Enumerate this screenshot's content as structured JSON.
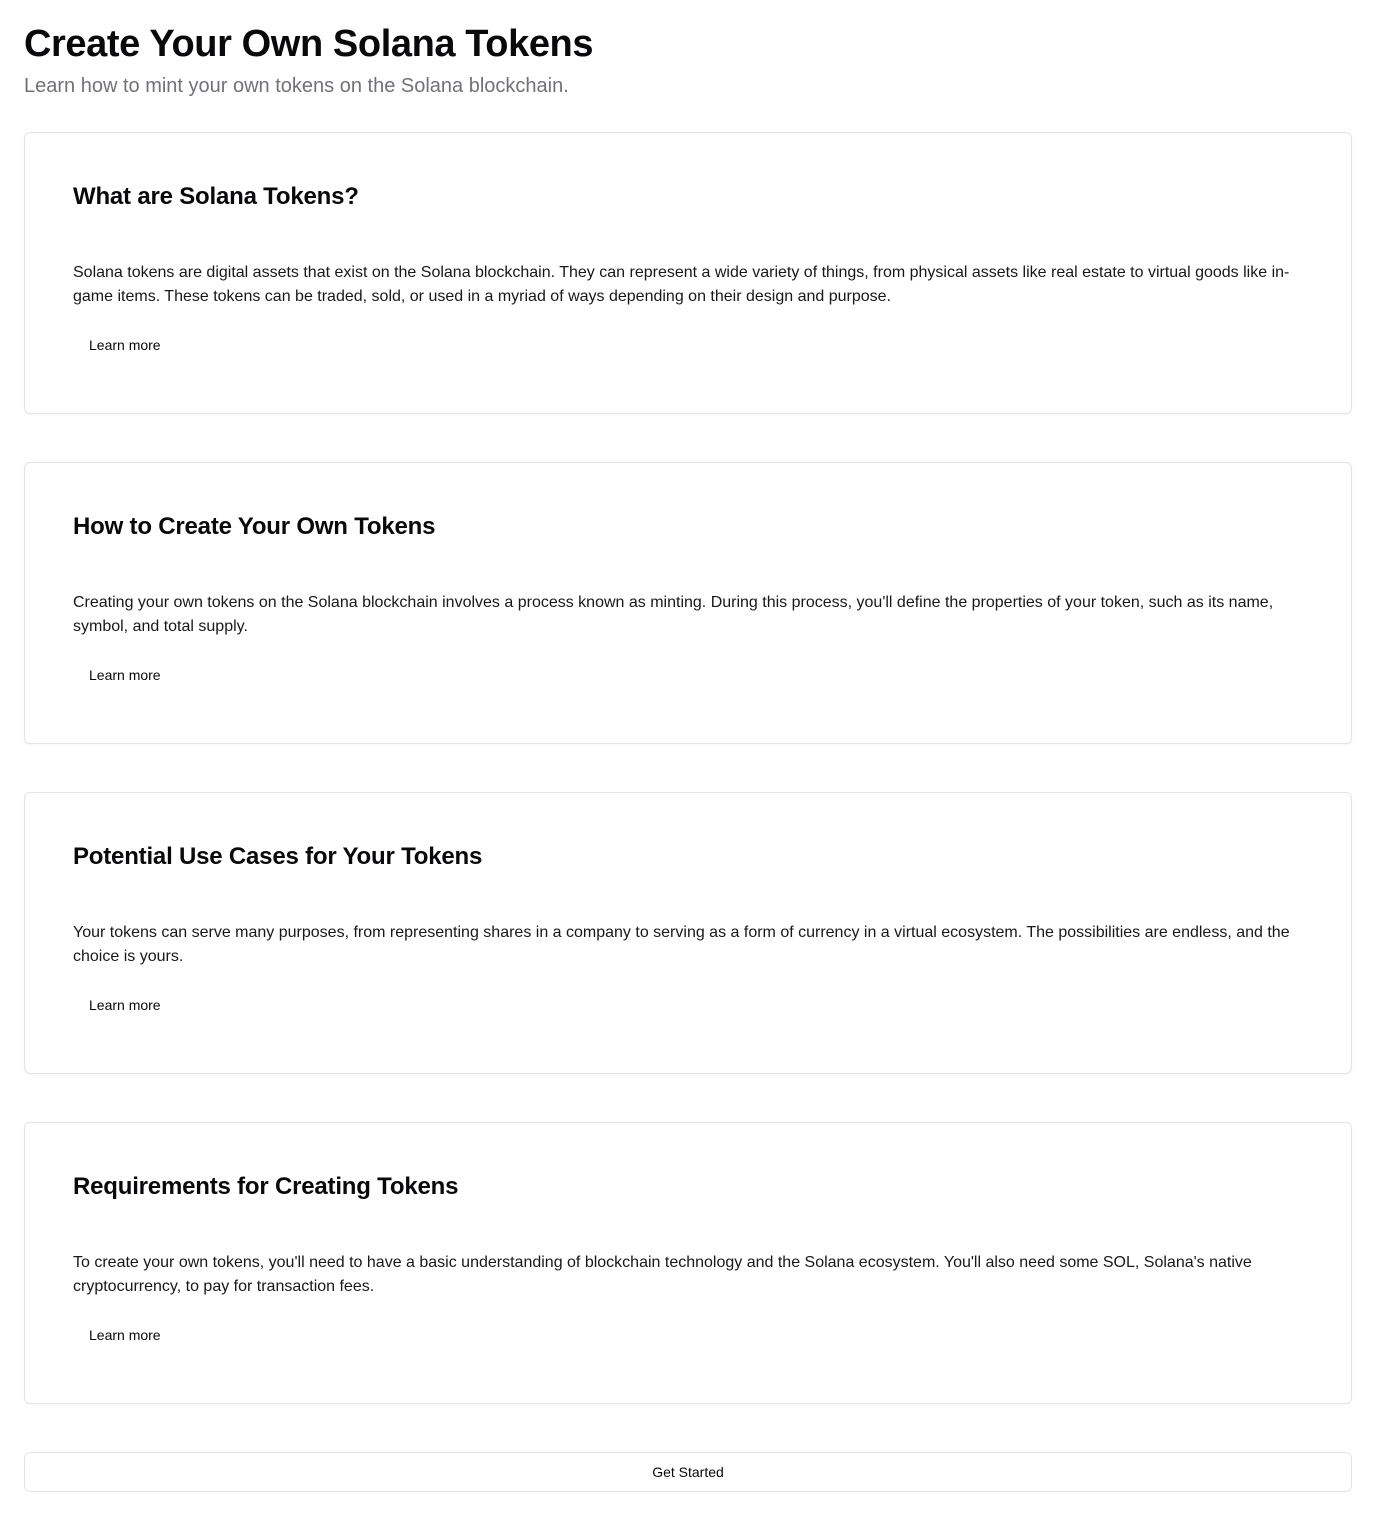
{
  "header": {
    "title": "Create Your Own Solana Tokens",
    "subtitle": "Learn how to mint your own tokens on the Solana blockchain."
  },
  "cards": [
    {
      "title": "What are Solana Tokens?",
      "body": "Solana tokens are digital assets that exist on the Solana blockchain. They can represent a wide variety of things, from physical assets like real estate to virtual goods like in-game items. These tokens can be traded, sold, or used in a myriad of ways depending on their design and purpose.",
      "button": "Learn more"
    },
    {
      "title": "How to Create Your Own Tokens",
      "body": "Creating your own tokens on the Solana blockchain involves a process known as minting. During this process, you'll define the properties of your token, such as its name, symbol, and total supply.",
      "button": "Learn more"
    },
    {
      "title": "Potential Use Cases for Your Tokens",
      "body": "Your tokens can serve many purposes, from representing shares in a company to serving as a form of currency in a virtual ecosystem. The possibilities are endless, and the choice is yours.",
      "button": "Learn more"
    },
    {
      "title": "Requirements for Creating Tokens",
      "body": "To create your own tokens, you'll need to have a basic understanding of blockchain technology and the Solana ecosystem. You'll also need some SOL, Solana's native cryptocurrency, to pay for transaction fees.",
      "button": "Learn more"
    }
  ],
  "footer": {
    "cta_label": "Get Started"
  }
}
